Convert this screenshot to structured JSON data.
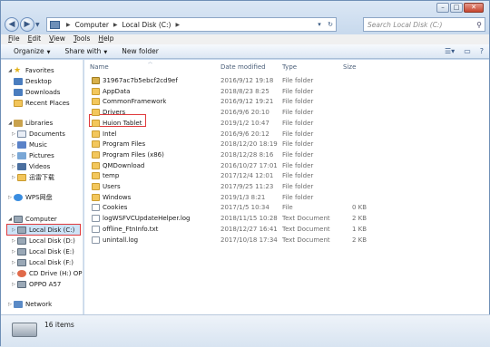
{
  "address": {
    "crumbs": [
      "Computer",
      "Local Disk (C:)"
    ]
  },
  "search": {
    "placeholder": "Search Local Disk (C:)"
  },
  "menu": [
    "File",
    "Edit",
    "View",
    "Tools",
    "Help"
  ],
  "menu_access": [
    "F",
    "E",
    "V",
    "T",
    "H"
  ],
  "commands": {
    "organize": "Organize",
    "share": "Share with",
    "new_folder": "New folder"
  },
  "columns": {
    "name": "Name",
    "date": "Date modified",
    "type": "Type",
    "size": "Size"
  },
  "nav": {
    "favorites": "Favorites",
    "desktop": "Desktop",
    "downloads": "Downloads",
    "recent": "Recent Places",
    "libraries": "Libraries",
    "documents": "Documents",
    "music": "Music",
    "pictures": "Pictures",
    "videos": "Videos",
    "xunlei": "迅雷下载",
    "wps": "WPS网盘",
    "computer": "Computer",
    "disk_c": "Local Disk (C:)",
    "disk_d": "Local Disk (D:)",
    "disk_e": "Local Disk (E:)",
    "disk_f": "Local Disk (F:)",
    "cd": "CD Drive (H:) OPPO",
    "oppo": "OPPO A57",
    "network": "Network"
  },
  "files": [
    {
      "name": "31967ac7b5ebcf2cd9ef",
      "date": "2016/9/12 19:18",
      "type": "File folder",
      "size": "",
      "icon": "folder-zip"
    },
    {
      "name": "AppData",
      "date": "2018/8/23 8:25",
      "type": "File folder",
      "size": "",
      "icon": "folder"
    },
    {
      "name": "CommonFramework",
      "date": "2016/9/12 19:21",
      "type": "File folder",
      "size": "",
      "icon": "folder"
    },
    {
      "name": "Drivers",
      "date": "2016/9/6 20:10",
      "type": "File folder",
      "size": "",
      "icon": "folder"
    },
    {
      "name": "Huion Tablet",
      "date": "2019/1/2 10:47",
      "type": "File folder",
      "size": "",
      "icon": "folder"
    },
    {
      "name": "Intel",
      "date": "2016/9/6 20:12",
      "type": "File folder",
      "size": "",
      "icon": "folder"
    },
    {
      "name": "Program Files",
      "date": "2018/12/20 18:19",
      "type": "File folder",
      "size": "",
      "icon": "folder"
    },
    {
      "name": "Program Files (x86)",
      "date": "2018/12/28 8:16",
      "type": "File folder",
      "size": "",
      "icon": "folder"
    },
    {
      "name": "QMDownload",
      "date": "2016/10/27 17:01",
      "type": "File folder",
      "size": "",
      "icon": "folder"
    },
    {
      "name": "temp",
      "date": "2017/12/4 12:01",
      "type": "File folder",
      "size": "",
      "icon": "folder"
    },
    {
      "name": "Users",
      "date": "2017/9/25 11:23",
      "type": "File folder",
      "size": "",
      "icon": "folder"
    },
    {
      "name": "Windows",
      "date": "2019/1/3 8:21",
      "type": "File folder",
      "size": "",
      "icon": "folder"
    },
    {
      "name": "Cookies",
      "date": "2017/1/5 10:34",
      "type": "File",
      "size": "0 KB",
      "icon": "file"
    },
    {
      "name": "logWSFVCUpdateHelper.log",
      "date": "2018/11/15 10:28",
      "type": "Text Document",
      "size": "2 KB",
      "icon": "text"
    },
    {
      "name": "offline_FtnInfo.txt",
      "date": "2018/12/27 16:41",
      "type": "Text Document",
      "size": "1 KB",
      "icon": "text"
    },
    {
      "name": "unintall.log",
      "date": "2017/10/18 17:34",
      "type": "Text Document",
      "size": "2 KB",
      "icon": "text"
    }
  ],
  "details": {
    "count": "16 items"
  }
}
